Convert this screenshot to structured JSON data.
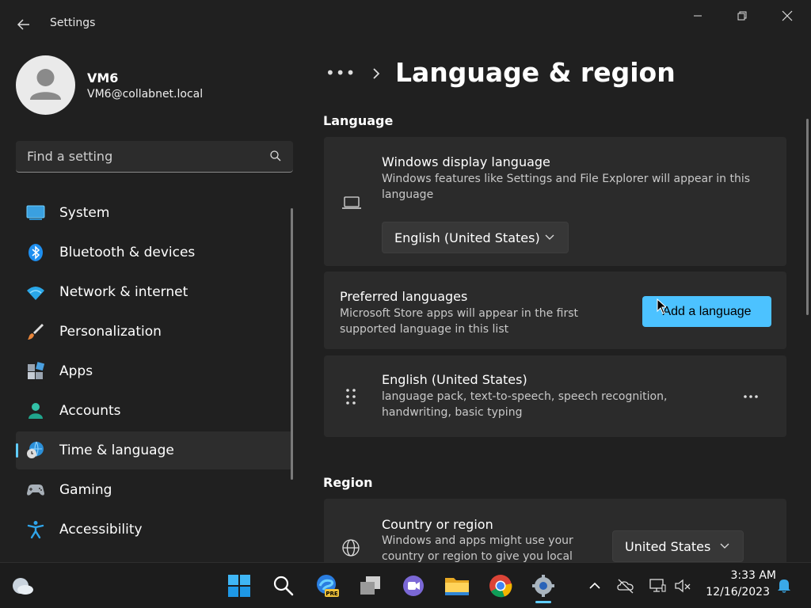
{
  "window": {
    "title": "Settings",
    "controls": {
      "minimize": "minimize-icon",
      "maximize": "restore-icon",
      "close": "close-icon"
    }
  },
  "user": {
    "name": "VM6",
    "email": "VM6@collabnet.local"
  },
  "search": {
    "placeholder": "Find a setting"
  },
  "sidebar": {
    "items": [
      {
        "label": "System",
        "icon": "system-icon"
      },
      {
        "label": "Bluetooth & devices",
        "icon": "bluetooth-icon"
      },
      {
        "label": "Network & internet",
        "icon": "wifi-icon"
      },
      {
        "label": "Personalization",
        "icon": "brush-icon"
      },
      {
        "label": "Apps",
        "icon": "apps-icon"
      },
      {
        "label": "Accounts",
        "icon": "account-icon"
      },
      {
        "label": "Time & language",
        "icon": "time-language-icon",
        "active": true
      },
      {
        "label": "Gaming",
        "icon": "gamepad-icon"
      },
      {
        "label": "Accessibility",
        "icon": "accessibility-icon"
      }
    ]
  },
  "main": {
    "breadcrumb_more": "•••",
    "page_title": "Language & region",
    "language_section": {
      "title": "Language",
      "display_language": {
        "title": "Windows display language",
        "description": "Windows features like Settings and File Explorer will appear in this language",
        "selected": "English (United States)"
      },
      "preferred": {
        "title": "Preferred languages",
        "description": "Microsoft Store apps will appear in the first supported language in this list",
        "button": "Add a language"
      },
      "languages": [
        {
          "name": "English (United States)",
          "features": "language pack, text-to-speech, speech recognition, handwriting, basic typing"
        }
      ]
    },
    "region_section": {
      "title": "Region",
      "country": {
        "title": "Country or region",
        "description": "Windows and apps might use your country or region to give you local",
        "selected": "United States"
      }
    }
  },
  "taskbar": {
    "apps": [
      "start-icon",
      "search-icon",
      "edge-pre-icon",
      "task-view-icon",
      "teams-icon",
      "file-explorer-icon",
      "chrome-icon",
      "settings-icon"
    ],
    "tray": [
      "chevron-up-icon",
      "onedrive-icon",
      "network-icon",
      "volume-muted-icon"
    ],
    "time": "3:33 AM",
    "date": "12/16/2023"
  },
  "colors": {
    "accent": "#4cc2ff",
    "background": "#202020",
    "card": "#2b2b2b"
  }
}
